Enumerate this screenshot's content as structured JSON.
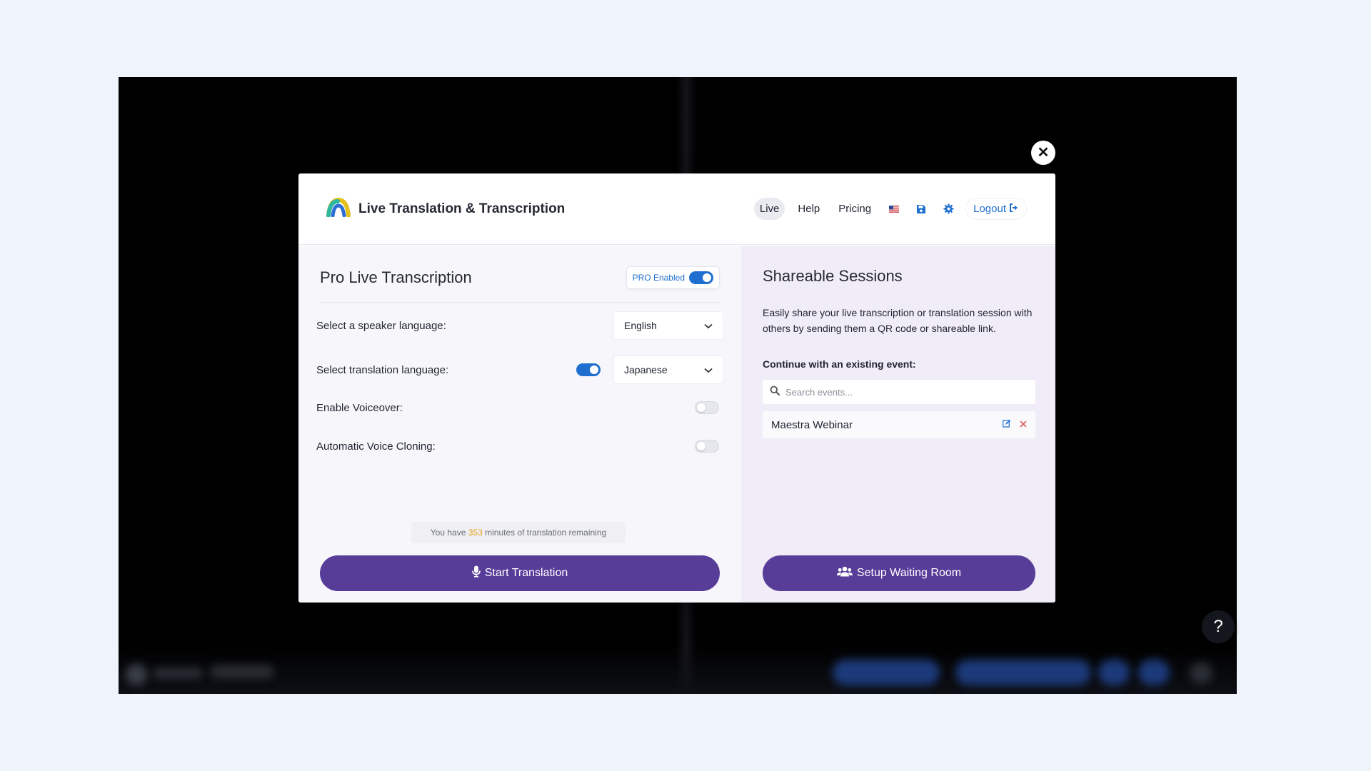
{
  "colors": {
    "accent_blue": "#1f6fd1",
    "primary_purple": "#573c98",
    "highlight_orange": "#e3a21a",
    "delete_red": "#e05a5a"
  },
  "header": {
    "title": "Live Translation & Transcription",
    "logo_icon": "rainbow-arc-logo",
    "nav": {
      "live": "Live",
      "help": "Help",
      "pricing": "Pricing",
      "logout": "Logout"
    },
    "icons": [
      "us-flag-icon",
      "save-icon",
      "gear-icon",
      "logout-icon"
    ]
  },
  "left_panel": {
    "title": "Pro Live Transcription",
    "pro_label": "PRO Enabled",
    "pro_enabled": true,
    "speaker_language": {
      "label": "Select a speaker language:",
      "value": "English"
    },
    "translation_language": {
      "label": "Select translation language:",
      "value": "Japanese",
      "enabled": true
    },
    "voiceover": {
      "label": "Enable Voiceover:",
      "enabled": false
    },
    "voice_cloning": {
      "label": "Automatic Voice Cloning:",
      "enabled": false
    },
    "remaining": {
      "prefix": "You have",
      "minutes": "353",
      "suffix": "minutes of translation remaining"
    },
    "start_button": "Start Translation"
  },
  "right_panel": {
    "title": "Shareable Sessions",
    "description": "Easily share your live transcription or translation session with others by sending them a QR code or shareable link.",
    "continue_label": "Continue with an existing event:",
    "search_placeholder": "Search events...",
    "events": [
      {
        "name": "Maestra Webinar"
      }
    ],
    "setup_button": "Setup Waiting Room"
  },
  "help_fab": "?",
  "close_symbol": "✕"
}
